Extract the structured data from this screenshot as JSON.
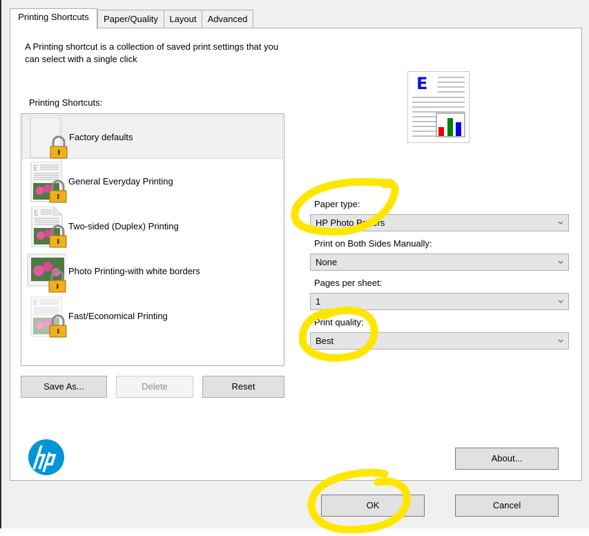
{
  "tabs": [
    {
      "label": "Printing Shortcuts",
      "active": true
    },
    {
      "label": "Paper/Quality",
      "active": false
    },
    {
      "label": "Layout",
      "active": false
    },
    {
      "label": "Advanced",
      "active": false
    }
  ],
  "description": "A Printing shortcut is a collection of saved print settings that you can select with a single click",
  "shortcuts": {
    "label": "Printing Shortcuts:",
    "items": [
      {
        "label": "Factory defaults",
        "icon": "blank-page-locked-icon",
        "selected": true
      },
      {
        "label": "General Everyday Printing",
        "icon": "document-photo-locked-icon",
        "selected": false
      },
      {
        "label": "Two-sided (Duplex) Printing",
        "icon": "duplex-document-locked-icon",
        "selected": false
      },
      {
        "label": "Photo Printing-with white borders",
        "icon": "photo-locked-icon",
        "selected": false
      },
      {
        "label": "Fast/Economical Printing",
        "icon": "faded-document-locked-icon",
        "selected": false
      }
    ]
  },
  "buttons": {
    "save_as": "Save As...",
    "delete": "Delete",
    "reset": "Reset",
    "about": "About...",
    "ok": "OK",
    "cancel": "Cancel"
  },
  "settings": {
    "paper_type": {
      "label": "Paper type:",
      "value": "HP Photo Papers"
    },
    "both_sides": {
      "label": "Print on Both Sides Manually:",
      "value": "None"
    },
    "pages_per_sheet": {
      "label": "Pages per sheet:",
      "value": "1"
    },
    "print_quality": {
      "label": "Print quality:",
      "value": "Best"
    }
  },
  "brand": {
    "logo_text": "hp",
    "color": "#0096d6"
  },
  "annotation_color": "#ffe600"
}
